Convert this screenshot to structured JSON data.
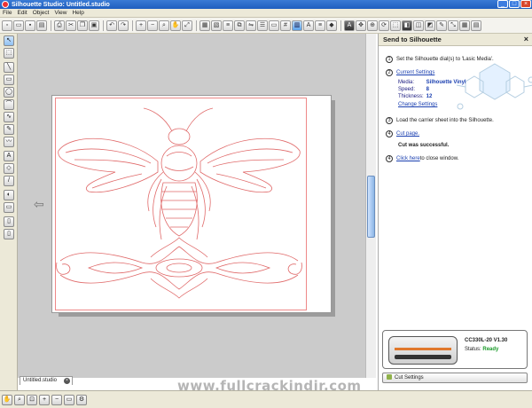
{
  "window": {
    "title": "Silhouette Studio: Untitled.studio",
    "buttons": [
      "_",
      "□",
      "×"
    ]
  },
  "menu": [
    "File",
    "Edit",
    "Object",
    "View",
    "Help"
  ],
  "document_tab": "Untitled.studio",
  "watermark": "www.fullcrackindir.com",
  "panel": {
    "title": "Send to Silhouette",
    "close": "×",
    "step1": "Set the Silhouette dial(s) to 'Lasic Media'.",
    "step2_label": "Current Settings",
    "media_label": "Media:",
    "media_value": "Silhouette Vinyl",
    "speed_label": "Speed:",
    "speed_value": "8",
    "thickness_label": "Thickness:",
    "thickness_value": "12",
    "change_settings": "Change Settings",
    "step3": "Load the carrier sheet into the Silhouette.",
    "step4_link": "Cut page.",
    "success": "Cut was successful.",
    "step5_link": "Click here",
    "step5_rest": " to close window.",
    "numbers": [
      "1",
      "2",
      "3",
      "4",
      "4"
    ],
    "device_model": "CC330L-20 V1.30",
    "status_label": "Status:",
    "status_value": "Ready",
    "cut_settings": "Cut Settings"
  },
  "colors": {
    "cut_line": "#e06a6a",
    "ready": "#1b9a2a",
    "link": "#1a3fb0"
  }
}
